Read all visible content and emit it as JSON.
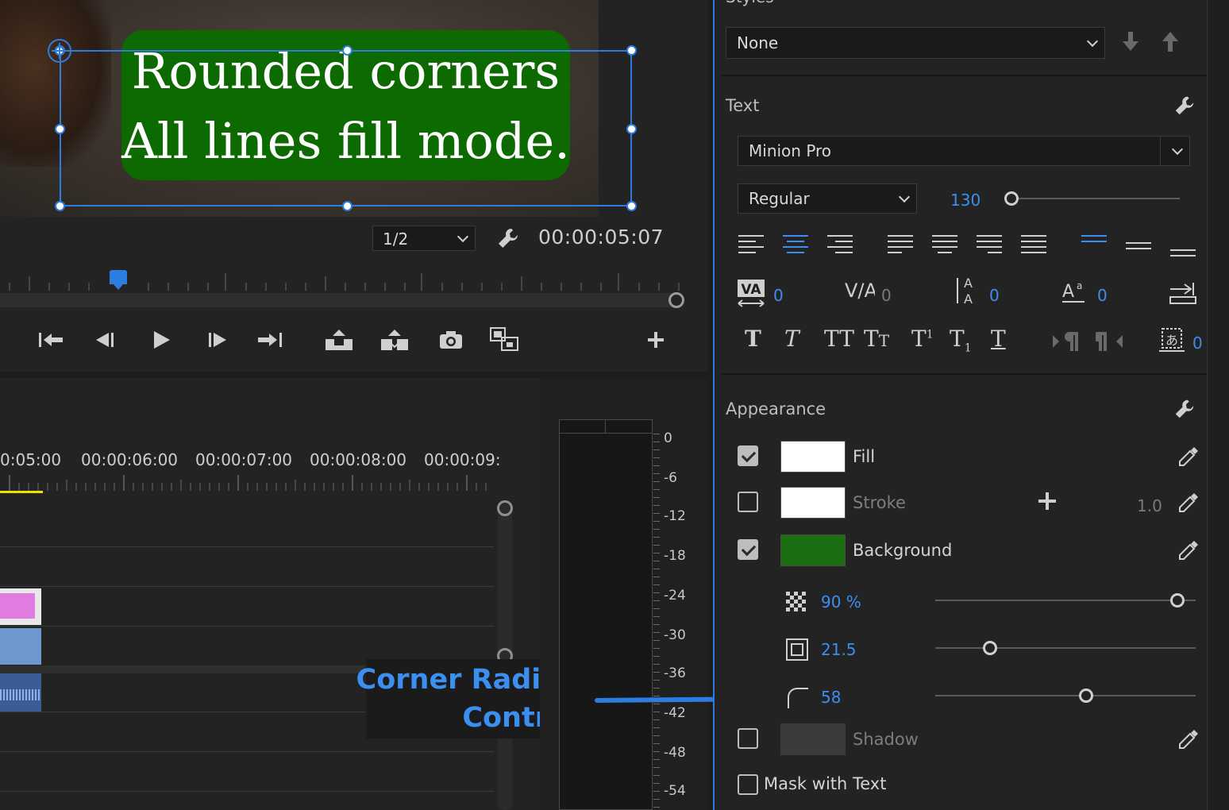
{
  "monitor": {
    "title_line1": "Rounded corners",
    "title_line2": "All lines fill mode.",
    "zoom": "1/2",
    "timecode": "00:00:05:07",
    "title_bg_color": "#0d6a00"
  },
  "transport": {
    "icons": [
      "go-to-in-icon",
      "step-back-icon",
      "play-icon",
      "step-forward-icon",
      "go-to-out-icon",
      "lift-icon",
      "extract-icon",
      "export-frame-icon",
      "compare-icon",
      "add-button-icon"
    ]
  },
  "timeline": {
    "timecodes": [
      "0:05:00",
      "00:00:06:00",
      "00:00:07:00",
      "00:00:08:00",
      "00:00:09:"
    ]
  },
  "callout": {
    "line1": "Corner Radius",
    "line2": "Control",
    "color": "#3b8ff0"
  },
  "meter": {
    "db_labels": [
      "0",
      "-6",
      "-12",
      "-18",
      "-24",
      "-30",
      "-36",
      "-42",
      "-48",
      "-54"
    ]
  },
  "panel": {
    "styles_label": "Styles",
    "styles_value": "None",
    "text_label": "Text",
    "font": "Minion Pro",
    "weight": "Regular",
    "font_size": "130",
    "kerning": "0",
    "tracking": "0",
    "leading": "0",
    "baseline_shift": "0",
    "tsume": "0",
    "appearance_label": "Appearance",
    "fill_label": "Fill",
    "stroke_label": "Stroke",
    "stroke_width": "1.0",
    "background_label": "Background",
    "bg_opacity": "90 %",
    "bg_size": "21.5",
    "corner_radius": "58",
    "shadow_label": "Shadow",
    "mask_label": "Mask with Text",
    "font_size_slider": 0.02,
    "opacity_slider": 0.93,
    "size_slider": 0.21,
    "radius_slider": 0.58,
    "fill_color": "#ffffff",
    "stroke_color": "#ffffff",
    "background_color": "#1c6e12",
    "accent_color": "#2d7de0"
  }
}
